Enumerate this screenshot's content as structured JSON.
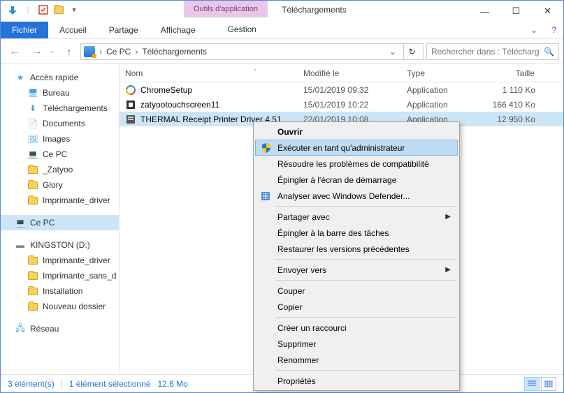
{
  "titlebar": {
    "contextual_tab": "Outils d'application",
    "title": "Téléchargements"
  },
  "ribbon": {
    "file": "Fichier",
    "tabs": [
      "Accueil",
      "Partage",
      "Affichage"
    ],
    "contextual": "Gestion"
  },
  "address": {
    "segments": [
      "Ce PC",
      "Téléchargements"
    ]
  },
  "search": {
    "placeholder": "Rechercher dans : Télécharge..."
  },
  "sidebar": {
    "quick_access": "Accès rapide",
    "quick_items": [
      "Bureau",
      "Téléchargements",
      "Documents",
      "Images",
      "Ce PC",
      "_Zatyoo",
      "Glory",
      "Imprimante_driver"
    ],
    "ce_pc": "Ce PC",
    "drive": "KINGSTON (D:)",
    "drive_items": [
      "Imprimante_driver",
      "Imprimante_sans_d",
      "Installation",
      "Nouveau dossier"
    ],
    "network": "Réseau"
  },
  "columns": {
    "name": "Nom",
    "date": "Modifié le",
    "type": "Type",
    "size": "Taille"
  },
  "files": [
    {
      "name": "ChromeSetup",
      "date": "15/01/2019 09:32",
      "type": "Application",
      "size": "1 110 Ko"
    },
    {
      "name": "zatyootouchscreen11",
      "date": "15/01/2019 10:22",
      "type": "Application",
      "size": "166 410 Ko"
    },
    {
      "name": "THERMAL Receipt Printer Driver 4.51",
      "date": "22/01/2019 10:08",
      "type": "Application",
      "size": "12 950 Ko"
    }
  ],
  "context_menu": {
    "open": "Ouvrir",
    "run_admin": "Exécuter en tant qu'administrateur",
    "compat": "Résoudre les problèmes de compatibilité",
    "pin_start": "Épingler à l'écran de démarrage",
    "defender": "Analyser avec Windows Defender...",
    "share": "Partager avec",
    "pin_taskbar": "Épingler à la barre des tâches",
    "restore": "Restaurer les versions précédentes",
    "send_to": "Envoyer vers",
    "cut": "Couper",
    "copy": "Copier",
    "shortcut": "Créer un raccourci",
    "delete": "Supprimer",
    "rename": "Renommer",
    "properties": "Propriétés"
  },
  "statusbar": {
    "count": "3 élément(s)",
    "selection": "1 élément sélectionné",
    "size": "12,6 Mo"
  }
}
